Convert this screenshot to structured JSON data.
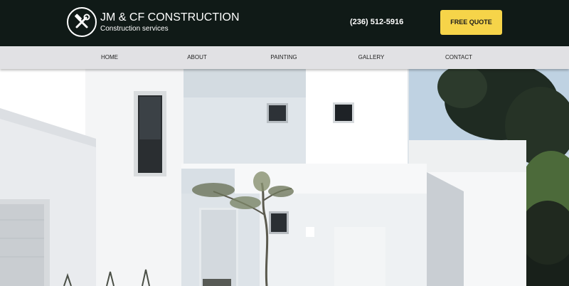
{
  "header": {
    "logo_icon": "hammer-wrench-icon",
    "brand_name": "JM & CF CONSTRUCTION",
    "tagline": "Construction services",
    "phone": "(236) 512-5916",
    "cta_label": "FREE QUOTE",
    "background_color": "#101a17",
    "accent_color": "#f6d449"
  },
  "nav": {
    "items": [
      {
        "label": "HOME"
      },
      {
        "label": "ABOUT"
      },
      {
        "label": "PAINTING"
      },
      {
        "label": "GALLERY"
      },
      {
        "label": "CONTACT"
      }
    ]
  },
  "hero": {
    "image_subject": "white modern house facade",
    "sky_color": "#cfdde8"
  }
}
